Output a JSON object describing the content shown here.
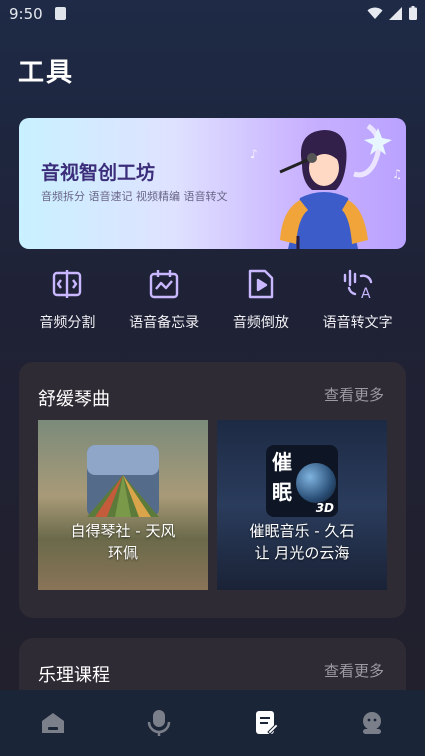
{
  "status": {
    "time": "9:50"
  },
  "page": {
    "title": "工具"
  },
  "banner": {
    "title": "音视智创工坊",
    "subtitle": "音频拆分 语音速记 视频精编 语音转文"
  },
  "tools": [
    {
      "label": "音频分割",
      "icon": "audio-split-icon"
    },
    {
      "label": "语音备忘录",
      "icon": "voice-memo-icon"
    },
    {
      "label": "音频倒放",
      "icon": "audio-reverse-icon"
    },
    {
      "label": "语音转文字",
      "icon": "speech-to-text-icon"
    }
  ],
  "piano": {
    "title": "舒缓琴曲",
    "more": "查看更多",
    "items": [
      {
        "line1": "自得琴社 - 天风",
        "line2": "环佩"
      },
      {
        "line1": "催眠音乐 - 久石",
        "line2": "让 月光の云海",
        "art_text": "催眠",
        "art_badge": "3D"
      }
    ]
  },
  "theory": {
    "title": "乐理课程",
    "more": "查看更多"
  },
  "tabbar": [
    {
      "name": "home",
      "icon": "home-icon",
      "active": false
    },
    {
      "name": "mic",
      "icon": "microphone-icon",
      "active": false
    },
    {
      "name": "tools",
      "icon": "notes-edit-icon",
      "active": true
    },
    {
      "name": "profile",
      "icon": "user-icon",
      "active": false
    }
  ]
}
